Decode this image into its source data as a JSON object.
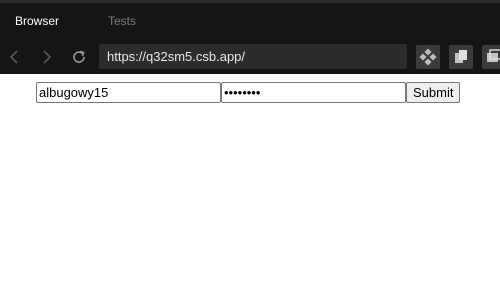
{
  "tabs": {
    "browser_label": "Browser",
    "tests_label": "Tests"
  },
  "toolbar": {
    "url": "https://q32sm5.csb.app/",
    "icons": [
      "chevron-left-icon",
      "chevron-right-icon",
      "refresh-icon",
      "move-icon",
      "copy-icon",
      "window-icon"
    ]
  },
  "form": {
    "username_value": "albugowy15",
    "password_value": "secret12",
    "submit_label": "Submit"
  },
  "colors": {
    "chrome_bg": "#151515",
    "url_bar_bg": "#2c2c2c",
    "active_tab_text": "#ffffff",
    "inactive_tab_text": "#7a7a7a"
  }
}
